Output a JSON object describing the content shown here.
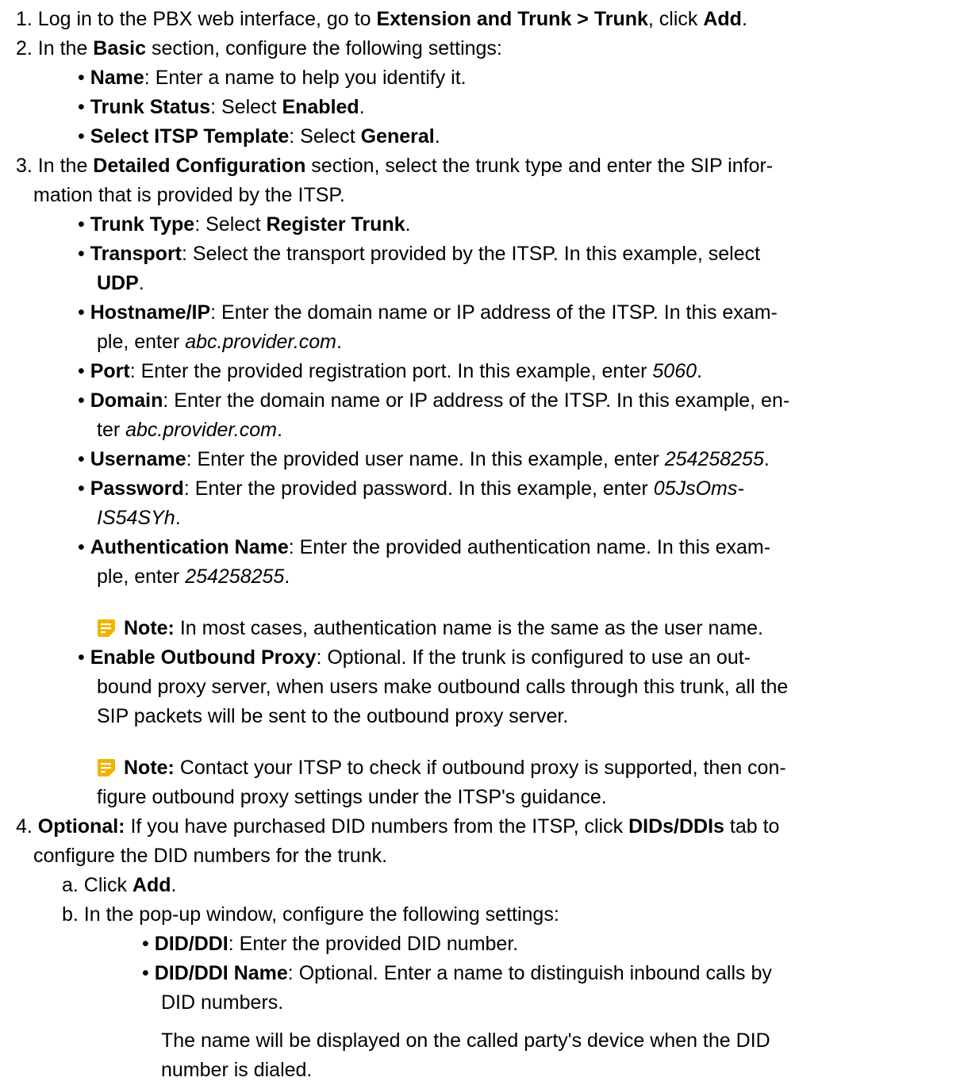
{
  "steps": {
    "s1": {
      "t1": "1. Log in to the PBX web interface, go to ",
      "t2": "Extension and Trunk > Trunk",
      "t3": ", click ",
      "t4": "Add",
      "t5": "."
    },
    "s2": {
      "t1": "2. In the ",
      "t2": "Basic",
      "t3": " section, configure the following settings:",
      "name": {
        "label": "Name",
        "text": ": Enter a name to help you identify it."
      },
      "status": {
        "label": "Trunk Status",
        "t1": ": Select ",
        "value": "Enabled",
        "t2": "."
      },
      "template": {
        "label": "Select ITSP Template",
        "t1": ": Select ",
        "value": "General",
        "t2": "."
      }
    },
    "s3": {
      "line1": {
        "t1": "3. In the ",
        "t2": "Detailed Configuration",
        "t3": " section, select the trunk type and enter the SIP infor-"
      },
      "line2": "mation that is provided by the ITSP.",
      "type": {
        "label": "Trunk Type",
        "t1": ": Select ",
        "value": "Register Trunk",
        "t2": "."
      },
      "transport": {
        "label": "Transport",
        "t1": ": Select the transport provided by the ITSP. In this example, select",
        "value": "UDP",
        "t2": "."
      },
      "host": {
        "label": "Hostname/IP",
        "t1": ": Enter the domain name or IP address of the ITSP. In this exam-",
        "t2": "ple, enter ",
        "value": "abc.provider.com",
        "t3": "."
      },
      "port": {
        "label": "Port",
        "t1": ": Enter the provided registration port. In this example, enter ",
        "value": "5060",
        "t2": "."
      },
      "domain": {
        "label": "Domain",
        "t1": ": Enter the domain name or IP address of the ITSP. In this example, en-",
        "t2": "ter ",
        "value": "abc.provider.com",
        "t3": "."
      },
      "username": {
        "label": "Username",
        "t1": ": Enter the provided user name. In this example, enter ",
        "value": "254258255",
        "t2": "."
      },
      "password": {
        "label": "Password",
        "t1": ": Enter the provided password. In this example, enter ",
        "value1": "05JsOms-",
        "value2": "IS54SYh",
        "t2": "."
      },
      "auth": {
        "label": "Authentication Name",
        "t1": ": Enter the provided authentication name. In this exam-",
        "t2": "ple, enter ",
        "value": "254258255",
        "t3": "."
      },
      "note1": {
        "label": "Note:",
        "text": "  In most cases, authentication name is the same as the user name."
      },
      "proxy": {
        "label": "Enable Outbound Proxy",
        "t1": ": Optional. If the trunk is configured to use an out-",
        "line2": "bound proxy server, when users make outbound calls through this trunk, all the",
        "line3": "SIP packets will be sent to the outbound proxy server."
      },
      "note2": {
        "label": "Note:",
        "text": "  Contact your ITSP to check if outbound proxy is supported, then con-",
        "line2": "figure outbound proxy settings under the ITSP's guidance."
      }
    },
    "s4": {
      "line1": {
        "t1": "4. ",
        "t2": "Optional:",
        "t3": " If you have purchased DID numbers from the ITSP, click ",
        "t4": "DIDs/DDIs",
        "t5": " tab to"
      },
      "line2": "configure the DID numbers for the trunk.",
      "a": {
        "t1": "a. Click ",
        "t2": "Add",
        "t3": "."
      },
      "b": "b. In the pop-up window, configure the following settings:",
      "did": {
        "label": "DID/DDI",
        "text": ": Enter the provided DID number."
      },
      "didname": {
        "label": "DID/DDI Name",
        "text": ": Optional. Enter a name to distinguish inbound calls by",
        "line2": "DID numbers."
      },
      "para": {
        "line1": "The name will be displayed on the called party's device when the DID",
        "line2": "number is dialed."
      }
    }
  },
  "icons": {
    "note": "note-icon",
    "note_color": "#f0b400"
  }
}
